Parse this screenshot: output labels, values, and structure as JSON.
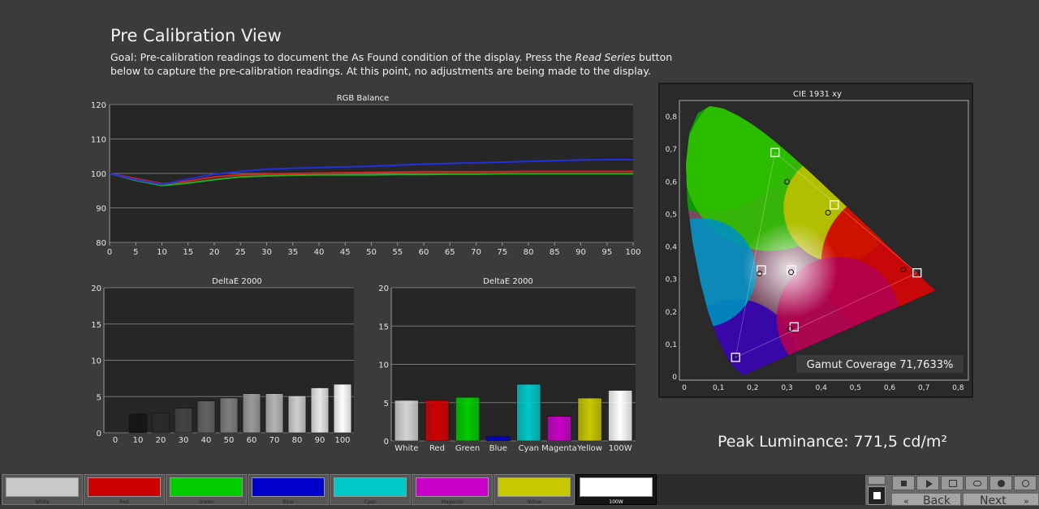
{
  "page": {
    "title": "Pre Calibration View",
    "goal_prefix": "Goal: Pre-calibration readings to document the As Found condition of the display. Press the ",
    "goal_italic": "Read Series",
    "goal_suffix": " button below to capture the pre-calibration readings. At this point, no adjustments are being made to the display."
  },
  "rgb_balance": {
    "title": "RGB Balance",
    "chart_data": {
      "type": "line",
      "title": "RGB Balance",
      "x": [
        0,
        5,
        10,
        15,
        20,
        25,
        30,
        35,
        40,
        45,
        50,
        55,
        60,
        65,
        70,
        75,
        80,
        85,
        90,
        95,
        100
      ],
      "xticks": [
        "0",
        "5",
        "10",
        "15",
        "20",
        "25",
        "30",
        "35",
        "40",
        "45",
        "50",
        "55",
        "60",
        "65",
        "70",
        "75",
        "80",
        "85",
        "90",
        "95",
        "100"
      ],
      "yticks": [
        "80",
        "90",
        "100",
        "110",
        "120"
      ],
      "ylim": [
        80,
        120
      ],
      "xlim": [
        0,
        100
      ],
      "series": [
        {
          "color": "#e02020",
          "values": [
            100,
            98.5,
            97,
            97.8,
            99,
            99.6,
            99.8,
            100,
            100.1,
            100.2,
            100.3,
            100.4,
            100.5,
            100.5,
            100.5,
            100.5,
            100.6,
            100.6,
            100.6,
            100.6,
            100.6
          ]
        },
        {
          "color": "#20b020",
          "values": [
            100,
            98,
            96.5,
            97.2,
            98.2,
            99,
            99.3,
            99.5,
            99.6,
            99.6,
            99.6,
            99.7,
            99.7,
            99.8,
            99.8,
            99.9,
            99.9,
            99.9,
            99.9,
            99.9,
            99.9
          ]
        },
        {
          "color": "#2030e0",
          "values": [
            100,
            98.2,
            96.8,
            98.4,
            99.8,
            100.6,
            101.2,
            101.5,
            101.7,
            101.9,
            102.1,
            102.4,
            102.7,
            102.9,
            103.1,
            103.3,
            103.5,
            103.7,
            103.9,
            104,
            104
          ]
        }
      ]
    }
  },
  "delta_gray": {
    "title": "DeltaE 2000",
    "chart_data": {
      "type": "bar",
      "title": "DeltaE 2000",
      "categories": [
        "0",
        "10",
        "20",
        "30",
        "40",
        "50",
        "60",
        "70",
        "80",
        "90",
        "100"
      ],
      "values": [
        0,
        2.6,
        2.7,
        3.4,
        4.4,
        4.8,
        5.4,
        5.4,
        5.1,
        6.2,
        6.7
      ],
      "colors": [
        "#000000",
        "#141414",
        "#2a2a2a",
        "#444444",
        "#626262",
        "#7e7e7e",
        "#9a9a9a",
        "#b5b5b5",
        "#cfcfcf",
        "#e8e8e8",
        "#ffffff"
      ],
      "yticks": [
        "0",
        "5",
        "10",
        "15",
        "20"
      ],
      "ylim": [
        0,
        20
      ]
    }
  },
  "delta_color": {
    "title": "DeltaE 2000",
    "chart_data": {
      "type": "bar",
      "title": "DeltaE 2000",
      "categories": [
        "White",
        "Red",
        "Green",
        "Blue",
        "Cyan",
        "Magenta",
        "Yellow",
        "100W"
      ],
      "values": [
        5.3,
        5.3,
        5.7,
        0.6,
        7.4,
        3.2,
        5.6,
        6.6
      ],
      "colors": [
        "#d4d4d4",
        "#d00000",
        "#00cc00",
        "#0000cc",
        "#00c8c8",
        "#c800c8",
        "#c8c800",
        "#ffffff"
      ],
      "yticks": [
        "0",
        "5",
        "10",
        "15",
        "20"
      ],
      "ylim": [
        0,
        20
      ]
    }
  },
  "cie": {
    "title": "CIE 1931 xy",
    "xticks": [
      "0",
      "0,1",
      "0,2",
      "0,3",
      "0,4",
      "0,5",
      "0,6",
      "0,7",
      "0,8"
    ],
    "yticks": [
      "0",
      "0,1",
      "0,2",
      "0,3",
      "0,4",
      "0,5",
      "0,6",
      "0,7",
      "0,8"
    ],
    "gamut_label": "Gamut Coverage 71,7633%",
    "chart_data": {
      "type": "scatter",
      "title": "CIE 1931 xy",
      "xlim": [
        0,
        0.8
      ],
      "ylim": [
        0,
        0.8
      ],
      "targets": [
        {
          "name": "Red",
          "x": 0.68,
          "y": 0.32
        },
        {
          "name": "Green",
          "x": 0.265,
          "y": 0.69
        },
        {
          "name": "Blue",
          "x": 0.15,
          "y": 0.06
        },
        {
          "name": "White",
          "x": 0.313,
          "y": 0.329
        },
        {
          "name": "Cyan",
          "x": 0.225,
          "y": 0.329
        },
        {
          "name": "Magenta",
          "x": 0.321,
          "y": 0.154
        },
        {
          "name": "Yellow",
          "x": 0.438,
          "y": 0.529
        }
      ],
      "measured": [
        {
          "name": "Red",
          "x": 0.64,
          "y": 0.33
        },
        {
          "name": "Green",
          "x": 0.3,
          "y": 0.6
        },
        {
          "name": "Blue",
          "x": 0.15,
          "y": 0.06
        },
        {
          "name": "White",
          "x": 0.312,
          "y": 0.322
        },
        {
          "name": "Cyan",
          "x": 0.22,
          "y": 0.318
        },
        {
          "name": "Magenta",
          "x": 0.308,
          "y": 0.148
        },
        {
          "name": "Yellow",
          "x": 0.42,
          "y": 0.505
        }
      ]
    }
  },
  "peak": {
    "label": "Peak Luminance: 771,5 cd/m²"
  },
  "swatches": [
    {
      "label": "White",
      "color": "#c8c8c8"
    },
    {
      "label": "Red",
      "color": "#cc0000"
    },
    {
      "label": "Green",
      "color": "#00cc00"
    },
    {
      "label": "Blue",
      "color": "#0000cc"
    },
    {
      "label": "Cyan",
      "color": "#00c8c8"
    },
    {
      "label": "Magenta",
      "color": "#c800c8"
    },
    {
      "label": "Yellow",
      "color": "#c8c800"
    },
    {
      "label": "100W",
      "color": "#ffffff"
    }
  ],
  "nav": {
    "back": "Back",
    "next": "Next"
  }
}
